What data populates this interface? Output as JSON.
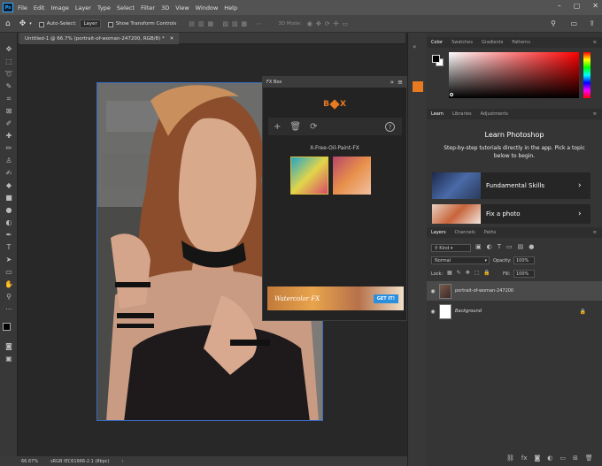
{
  "menubar": {
    "logo": "Ps",
    "items": [
      "File",
      "Edit",
      "Image",
      "Layer",
      "Type",
      "Select",
      "Filter",
      "3D",
      "View",
      "Window",
      "Help"
    ]
  },
  "options": {
    "auto_select": "Auto-Select:",
    "layer_select": "Layer",
    "show_transform": "Show Transform Controls",
    "mode_3d": "3D Mode:"
  },
  "document": {
    "tab_title": "Untitled-1 @ 66.7% (portrait-of-woman-247200, RGB/8) *",
    "zoom": "66.67%",
    "profile": "sRGB IEC61966-2.1 (8bpc)"
  },
  "fxbox": {
    "title": "FX Box",
    "preset_name": "X-Free-Oil-Paint-FX",
    "banner_text": "Watercolor FX",
    "banner_button": "GET IT!"
  },
  "color_panel": {
    "tabs": [
      "Color",
      "Swatches",
      "Gradients",
      "Patterns"
    ],
    "accent": "#ff0000"
  },
  "learn_panel": {
    "tabs": [
      "Learn",
      "Libraries",
      "Adjustments"
    ],
    "title": "Learn Photoshop",
    "description": "Step-by-step tutorials directly in the app. Pick a topic below to begin.",
    "cards": [
      "Fundamental Skills",
      "Fix a photo"
    ]
  },
  "layers_panel": {
    "tabs": [
      "Layers",
      "Channels",
      "Paths"
    ],
    "kind": "Kind",
    "blend_mode": "Normal",
    "opacity_label": "Opacity:",
    "opacity_value": "100%",
    "lock_label": "Lock:",
    "fill_label": "Fill:",
    "fill_value": "100%",
    "layers": [
      {
        "name": "portrait-of-woman-247200"
      },
      {
        "name": "Background"
      }
    ]
  }
}
